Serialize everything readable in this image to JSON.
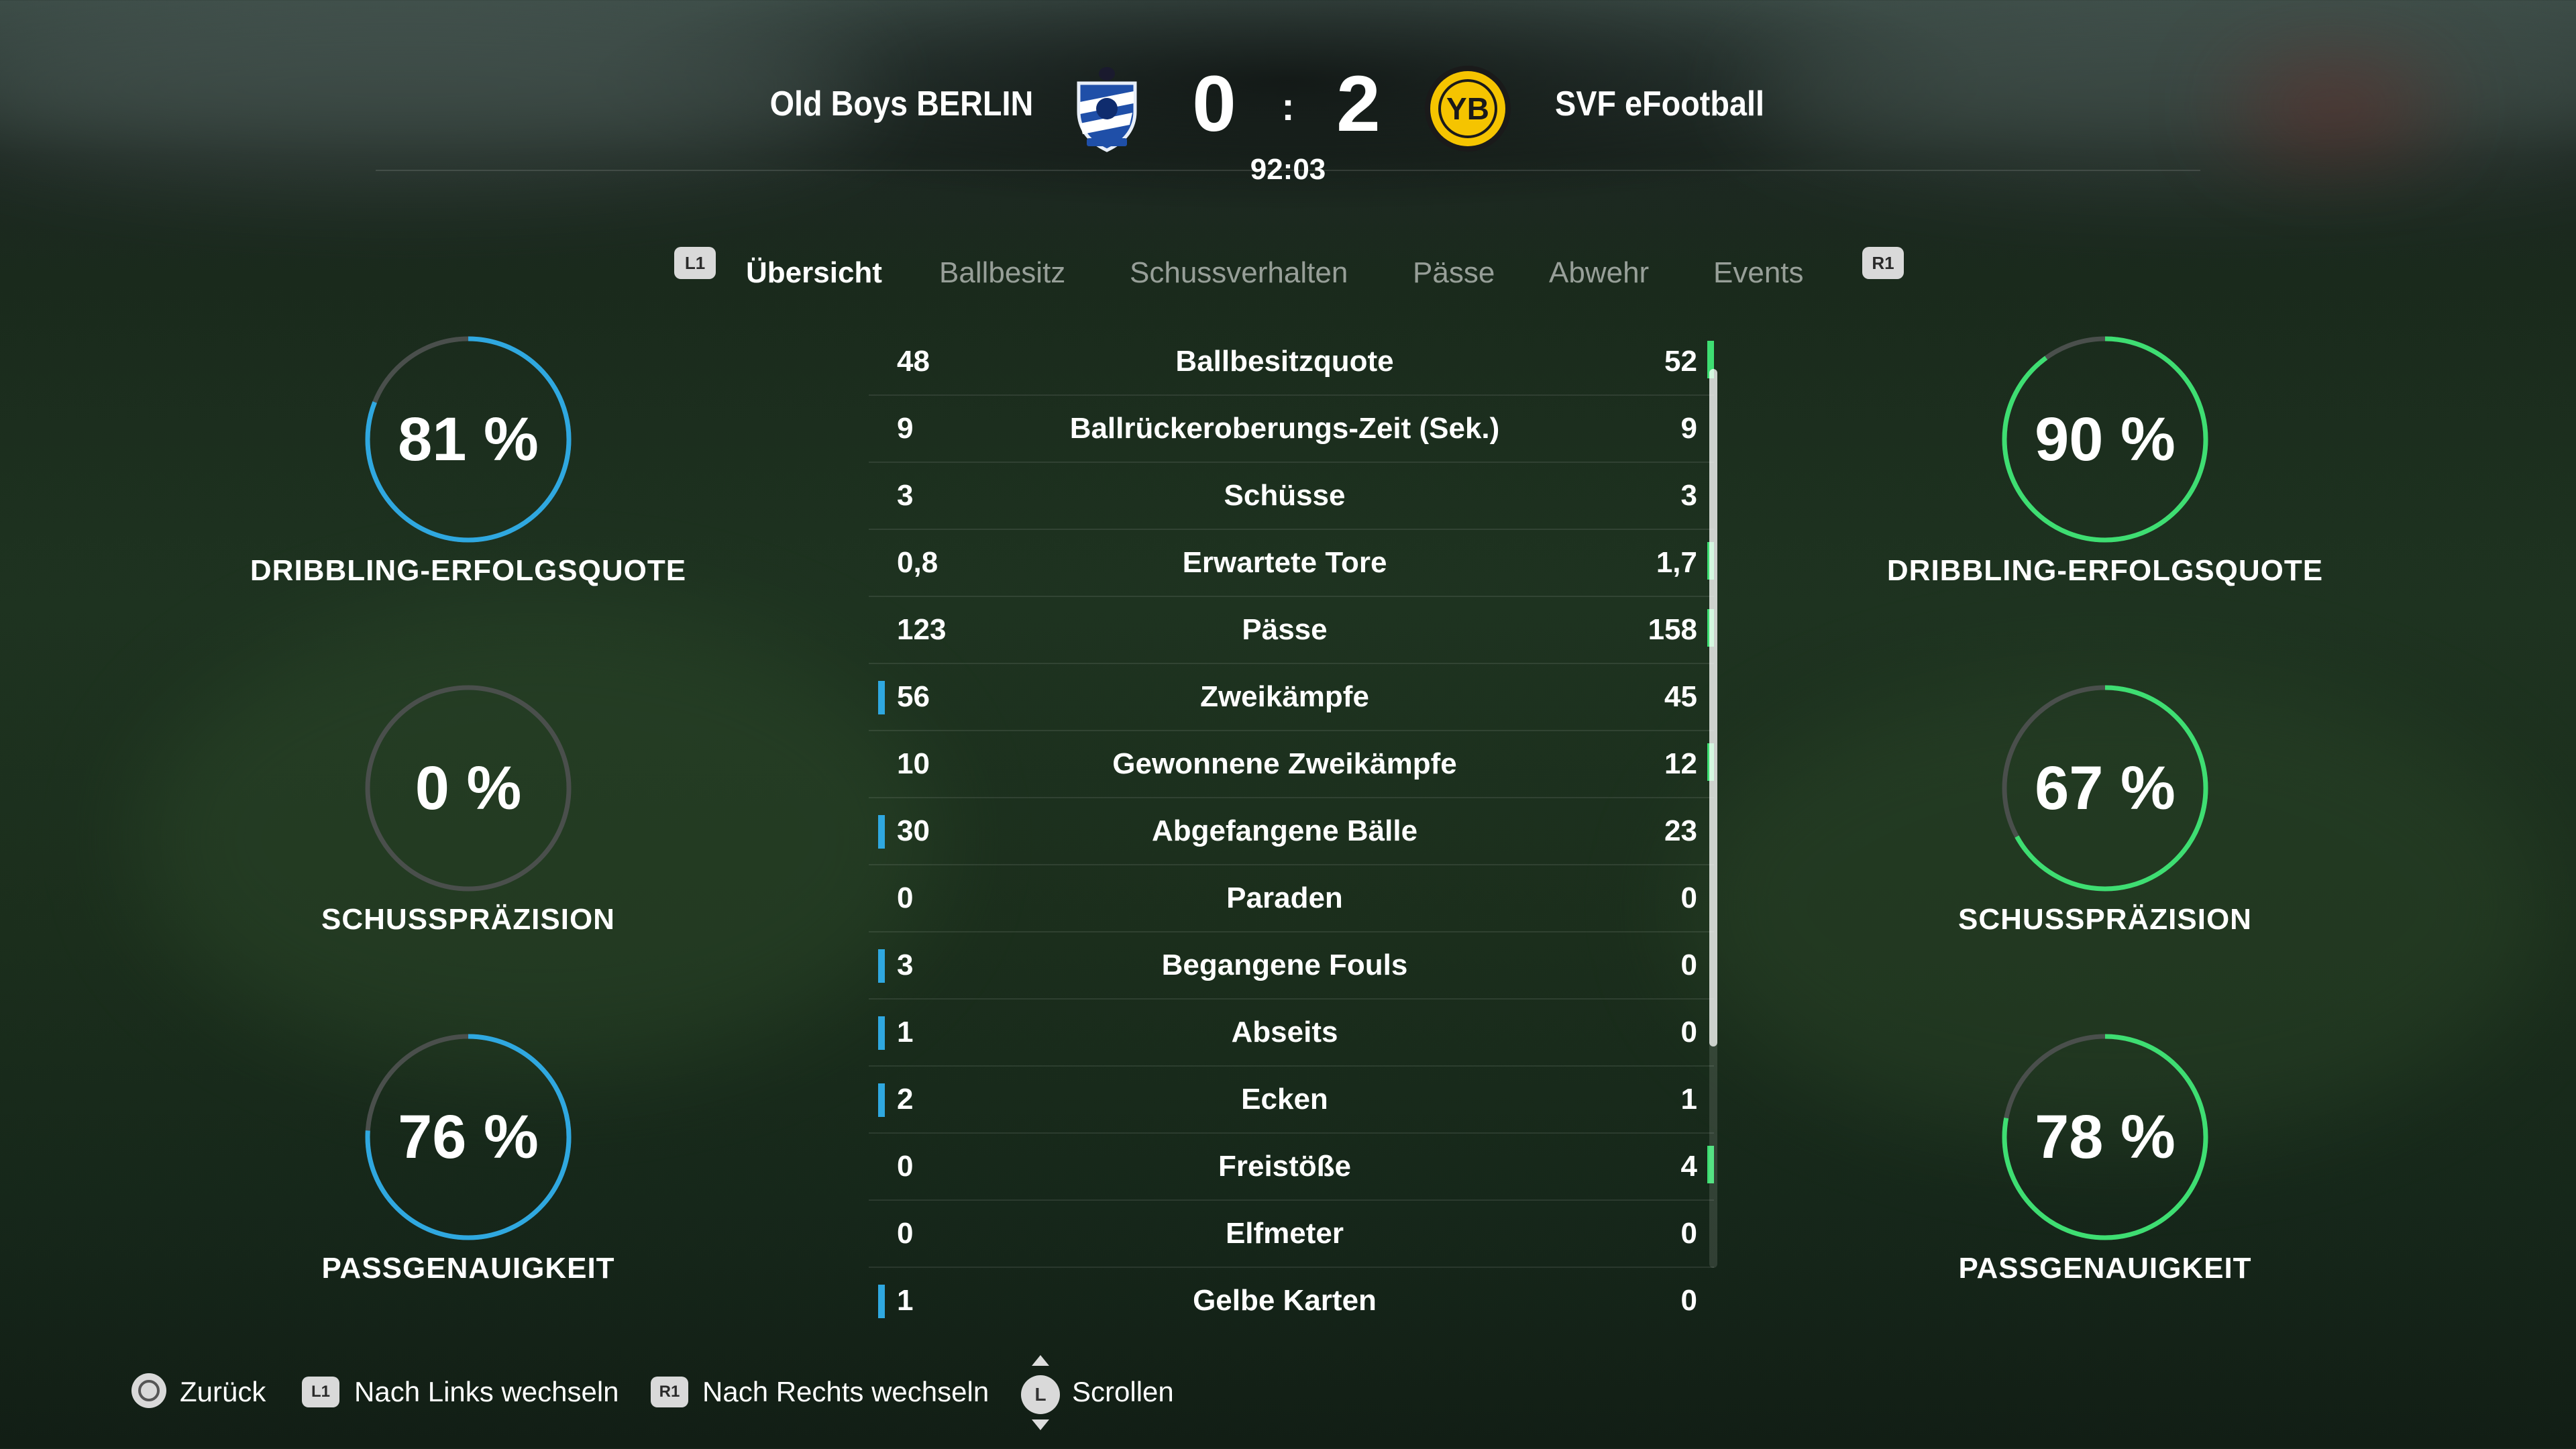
{
  "header": {
    "home_team": "Old Boys BERLIN",
    "away_team": "SVF eFootball",
    "home_score": "0",
    "away_score": "2",
    "separator": ":",
    "clock": "92:03",
    "home_crest_icon": "blue-white-club-crest-icon",
    "away_crest_icon": "yellow-black-yb-crest-icon"
  },
  "tabs": {
    "prev_button": "L1",
    "next_button": "R1",
    "items": [
      {
        "label": "Übersicht",
        "active": true
      },
      {
        "label": "Ballbesitz",
        "active": false
      },
      {
        "label": "Schussverhalten",
        "active": false
      },
      {
        "label": "Pässe",
        "active": false
      },
      {
        "label": "Abwehr",
        "active": false
      },
      {
        "label": "Events",
        "active": false
      }
    ]
  },
  "home_gauges": [
    {
      "value": "81 %",
      "fraction": 0.81,
      "label": "DRIBBLING-ERFOLGSQUOTE"
    },
    {
      "value": "0 %",
      "fraction": 0.0,
      "label": "SCHUSSPRÄZISION"
    },
    {
      "value": "76 %",
      "fraction": 0.76,
      "label": "PASSGENAUIGKEIT"
    }
  ],
  "away_gauges": [
    {
      "value": "90 %",
      "fraction": 0.9,
      "label": "DRIBBLING-ERFOLGSQUOTE"
    },
    {
      "value": "67 %",
      "fraction": 0.67,
      "label": "SCHUSSPRÄZISION"
    },
    {
      "value": "78 %",
      "fraction": 0.78,
      "label": "PASSGENAUIGKEIT"
    }
  ],
  "stats": [
    {
      "home": "48",
      "name": "Ballbesitzquote",
      "away": "52",
      "leader": "away"
    },
    {
      "home": "9",
      "name": "Ballrückeroberungs-Zeit (Sek.)",
      "away": "9",
      "leader": "none"
    },
    {
      "home": "3",
      "name": "Schüsse",
      "away": "3",
      "leader": "none"
    },
    {
      "home": "0,8",
      "name": "Erwartete Tore",
      "away": "1,7",
      "leader": "away"
    },
    {
      "home": "123",
      "name": "Pässe",
      "away": "158",
      "leader": "away"
    },
    {
      "home": "56",
      "name": "Zweikämpfe",
      "away": "45",
      "leader": "home"
    },
    {
      "home": "10",
      "name": "Gewonnene Zweikämpfe",
      "away": "12",
      "leader": "away"
    },
    {
      "home": "30",
      "name": "Abgefangene Bälle",
      "away": "23",
      "leader": "home"
    },
    {
      "home": "0",
      "name": "Paraden",
      "away": "0",
      "leader": "none"
    },
    {
      "home": "3",
      "name": "Begangene Fouls",
      "away": "0",
      "leader": "home"
    },
    {
      "home": "1",
      "name": "Abseits",
      "away": "0",
      "leader": "home"
    },
    {
      "home": "2",
      "name": "Ecken",
      "away": "1",
      "leader": "home"
    },
    {
      "home": "0",
      "name": "Freistöße",
      "away": "4",
      "leader": "away"
    },
    {
      "home": "0",
      "name": "Elfmeter",
      "away": "0",
      "leader": "none"
    },
    {
      "home": "1",
      "name": "Gelbe Karten",
      "away": "0",
      "leader": "home"
    }
  ],
  "footer": {
    "back": "Zurück",
    "left_button": "L1",
    "left_label": "Nach Links wechseln",
    "right_button": "R1",
    "right_label": "Nach Rechts wechseln",
    "stick_button": "L",
    "scroll_label": "Scrollen"
  },
  "colors": {
    "home_accent": "#2fa8e0",
    "away_accent": "#3ede72",
    "gauge_track": "#4a4f4c"
  }
}
